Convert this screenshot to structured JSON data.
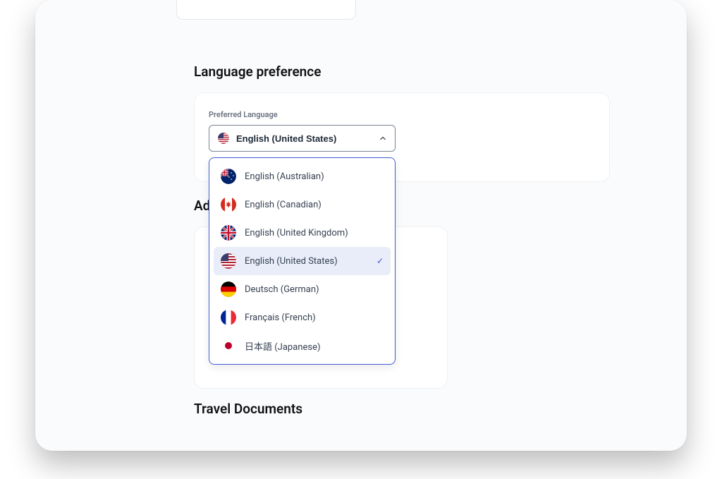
{
  "sections": {
    "language": {
      "heading": "Language preference",
      "field_label": "Preferred Language",
      "selected": "English (United States)",
      "options": [
        {
          "label": "English (Australian)",
          "flag": "au",
          "selected": false
        },
        {
          "label": "English (Canadian)",
          "flag": "ca",
          "selected": false
        },
        {
          "label": "English (United Kingdom)",
          "flag": "gb",
          "selected": false
        },
        {
          "label": "English (United States)",
          "flag": "us",
          "selected": true
        },
        {
          "label": "Deutsch (German)",
          "flag": "de",
          "selected": false
        },
        {
          "label": "Français (French)",
          "flag": "fr",
          "selected": false
        },
        {
          "label": "日本語 (Japanese)",
          "flag": "jp",
          "selected": false
        }
      ]
    },
    "additional": {
      "heading_partial": "Add"
    },
    "travel": {
      "heading": "Travel Documents"
    }
  }
}
